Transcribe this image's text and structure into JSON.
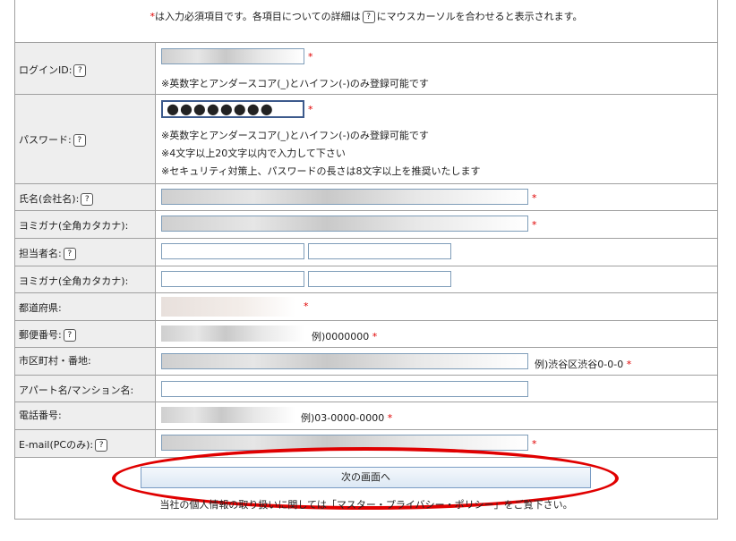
{
  "intro": {
    "star": "*",
    "text_before": "は入力必須項目です。各項目についての詳細は",
    "text_after": "にマウスカーソルを合わせると表示されます。"
  },
  "help_icon_glyph": "?",
  "required_mark": "*",
  "fields": {
    "login_id": {
      "label": "ログインID:",
      "note": "※英数字とアンダースコア(_)とハイフン(-)のみ登録可能です"
    },
    "password": {
      "label": "パスワード:",
      "masked_value": "●●●●●●●●",
      "notes": [
        "※英数字とアンダースコア(_)とハイフン(-)のみ登録可能です",
        "※4文字以上20文字以内で入力して下さい",
        "※セキュリティ対策上、パスワードの長さは8文字以上を推奨いたします"
      ]
    },
    "name": {
      "label": "氏名(会社名):"
    },
    "name_kana": {
      "label": "ヨミガナ(全角カタカナ):"
    },
    "contact": {
      "label": "担当者名:"
    },
    "contact_kana": {
      "label": "ヨミガナ(全角カタカナ):"
    },
    "prefecture": {
      "label": "都道府県:"
    },
    "postal": {
      "label": "郵便番号:",
      "example": "例)0000000"
    },
    "city": {
      "label": "市区町村・番地:",
      "example": "例)渋谷区渋谷0-0-0"
    },
    "apartment": {
      "label": "アパート名/マンション名:"
    },
    "phone": {
      "label": "電話番号:",
      "example": "例)03-0000-0000"
    },
    "email": {
      "label": "E-mail(PCのみ):"
    }
  },
  "submit_label": "次の画面へ",
  "footer": "当社の個人情報の取り扱いに関しては「マスター・プライバシー・ポリシー」をご覧下さい。",
  "colors": {
    "required": "#e00000",
    "label_bg": "#eeeeee",
    "input_border": "#7f9db9",
    "highlight_ellipse": "#e00000"
  }
}
